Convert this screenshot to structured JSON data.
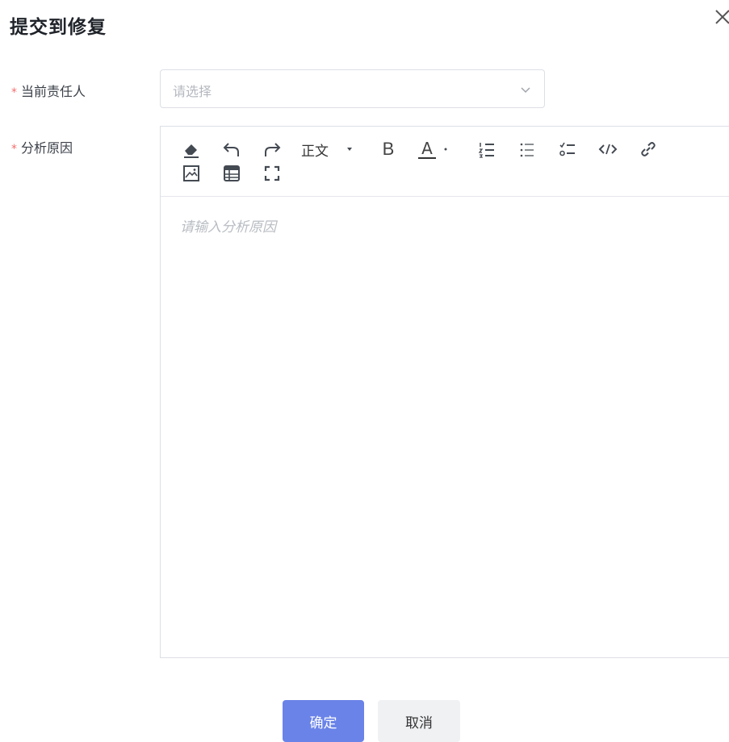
{
  "dialog": {
    "title": "提交到修复",
    "close_icon": "close-icon"
  },
  "form": {
    "assignee": {
      "required_mark": "*",
      "label": "当前责任人",
      "placeholder": "请选择",
      "icon": "chevron-down-icon"
    },
    "analysis": {
      "required_mark": "*",
      "label": "分析原因",
      "placeholder": "请输入分析原因"
    }
  },
  "toolbar": {
    "heading_label": "正文",
    "bold_label": "B",
    "text_color_label": "A",
    "icons": [
      "eraser-icon",
      "undo-icon",
      "redo-icon",
      "heading-dropdown-icon",
      "bold-icon",
      "text-color-icon",
      "ordered-list-icon",
      "bullet-list-icon",
      "task-list-icon",
      "code-icon",
      "link-icon",
      "image-icon",
      "table-icon",
      "fullscreen-icon"
    ]
  },
  "buttons": {
    "confirm": "确定",
    "cancel": "取消"
  },
  "colors": {
    "primary": "#6a83e8",
    "required": "#f56c6c",
    "border": "#dcdfe6",
    "placeholder": "#b4b8bf"
  }
}
